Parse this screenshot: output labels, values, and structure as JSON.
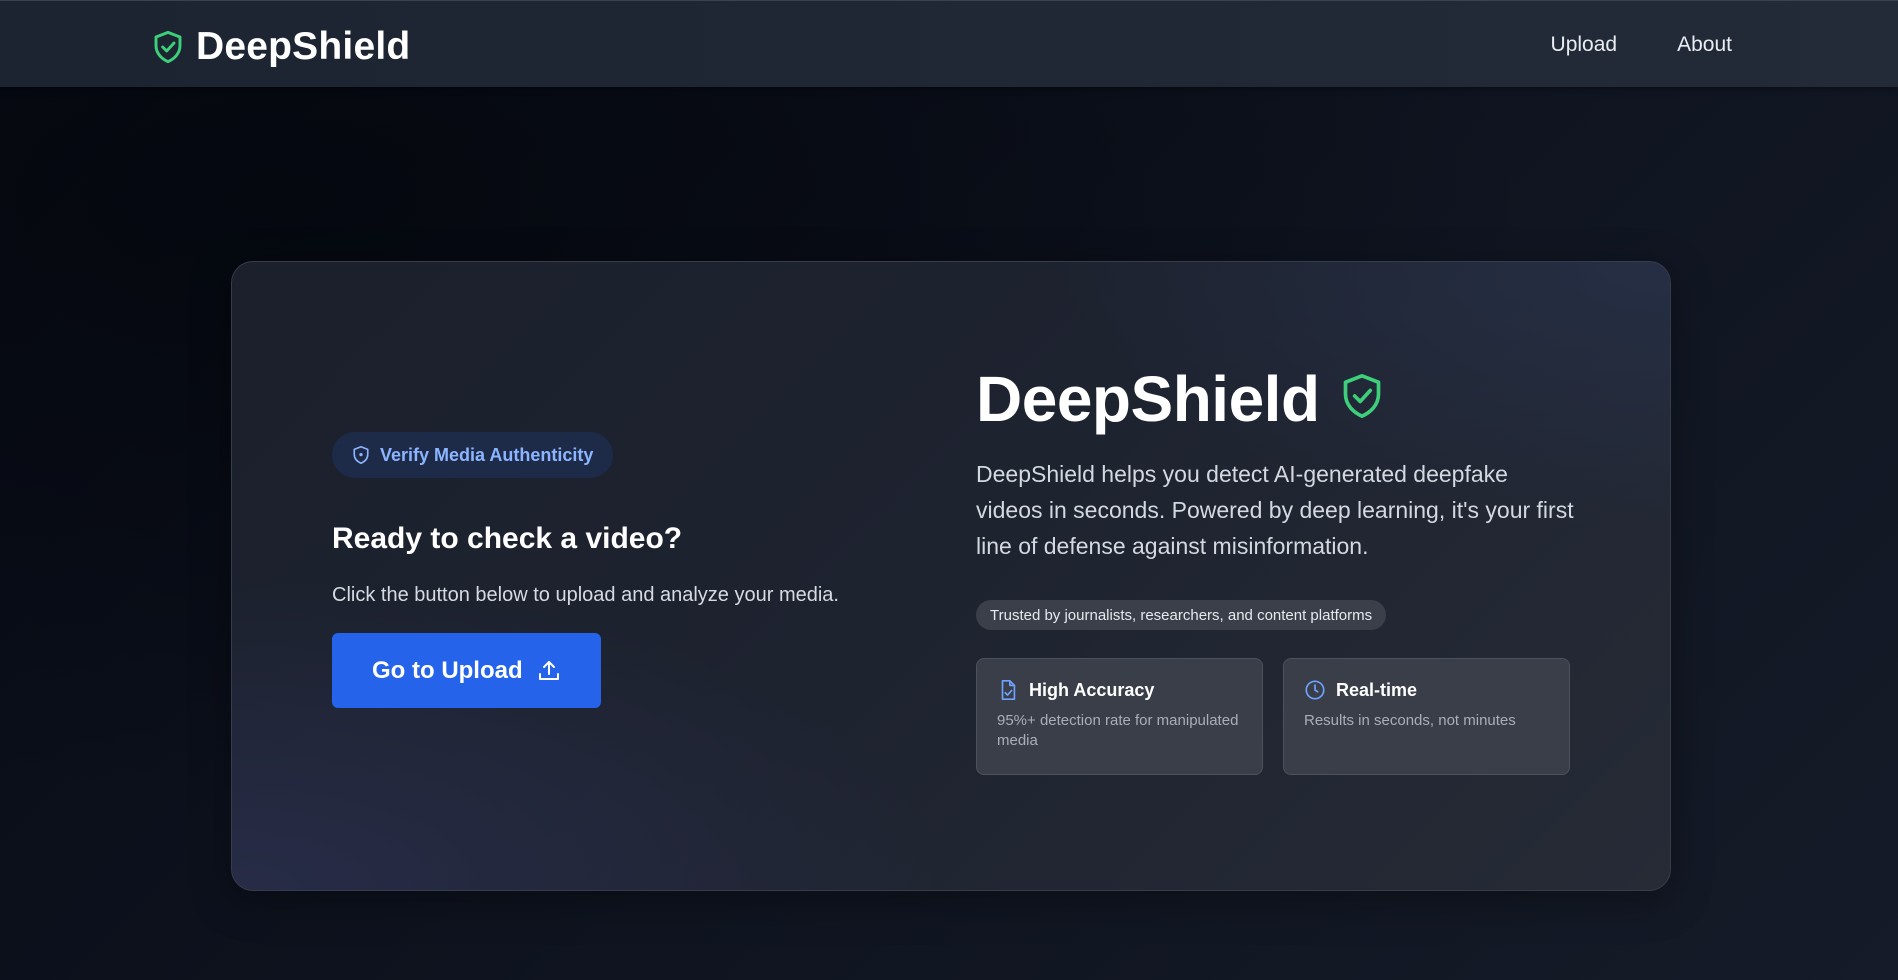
{
  "header": {
    "brand": "DeepShield",
    "brand_icon": "shield-check-icon",
    "nav": [
      {
        "label": "Upload"
      },
      {
        "label": "About"
      }
    ]
  },
  "hero": {
    "badge": {
      "label": "Verify Media Authenticity",
      "icon": "shield-icon"
    },
    "heading": "Ready to check a video?",
    "description": "Click the button below to upload and analyze your media.",
    "cta": {
      "label": "Go to Upload",
      "icon": "upload-icon"
    }
  },
  "info": {
    "title": "DeepShield",
    "title_icon": "shield-check-icon",
    "description": "DeepShield helps you detect AI-generated deepfake videos in seconds. Powered by deep learning, it's your first line of defense against misinformation.",
    "trust": "Trusted by journalists, researchers, and content platforms",
    "features": [
      {
        "title": "High Accuracy",
        "description": "95%+ detection rate for manipulated media",
        "icon": "document-check-icon"
      },
      {
        "title": "Real-time",
        "description": "Results in seconds, not minutes",
        "icon": "clock-icon"
      }
    ]
  },
  "colors": {
    "accent": "#2563eb",
    "shield_green": "#3ecf7a",
    "badge_text": "#8cb5ff"
  }
}
